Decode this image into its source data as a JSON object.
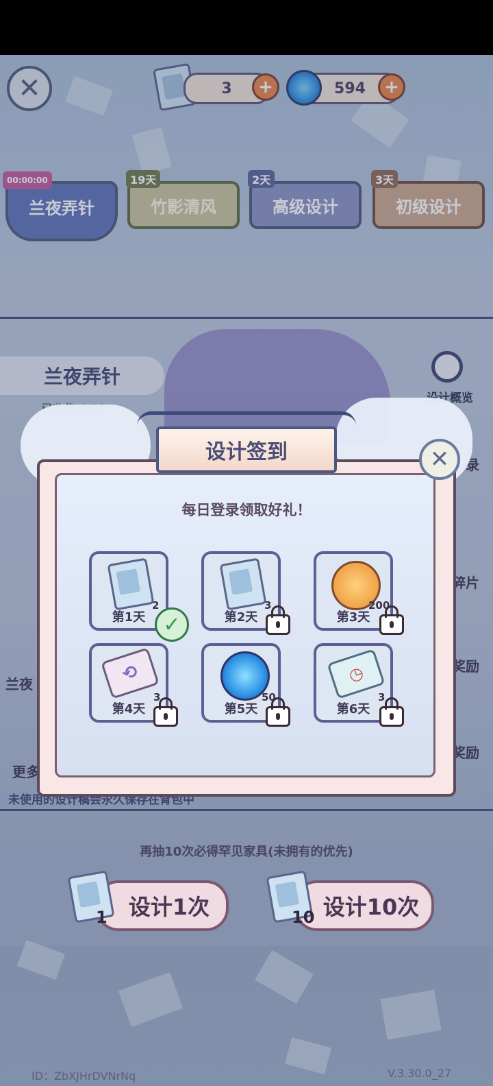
{
  "resources": [
    {
      "icon": "design-scroll-icon",
      "value": "3"
    },
    {
      "icon": "swirl-gem-icon",
      "value": "594"
    }
  ],
  "tabs": [
    {
      "label": "兰夜弄针",
      "tag": "00:00:00",
      "color": "#5b72b8"
    },
    {
      "label": "竹影清风",
      "tag": "19天",
      "color": "#c8c39a"
    },
    {
      "label": "高级设计",
      "tag": "2天",
      "color": "#8a93c2"
    },
    {
      "label": "初级设计",
      "tag": "3天",
      "color": "#c9a98d"
    }
  ],
  "banner": {
    "title": "兰夜弄针",
    "progress": "已收集 0/21"
  },
  "side": {
    "overview": "设计概览",
    "record_suffix": "录",
    "fragment_suffix": "碎片",
    "reward1_suffix": "奖励",
    "reward2_suffix": "奖励",
    "left_label1": "兰夜",
    "left_label2": "更多"
  },
  "notice": "未使用的设计稿会永久保存在背包中",
  "guarantee": "再抽10次必得罕见家具(未拥有的优先)",
  "draw": {
    "single": {
      "label": "设计1次",
      "cost": "1"
    },
    "ten": {
      "label": "设计10次",
      "cost": "10"
    }
  },
  "footer": {
    "id": "ID：ZbXJHrDVNrNq",
    "version": "V.3.30.0_27"
  },
  "modal": {
    "title": "设计签到",
    "subtitle": "每日登录领取好礼！",
    "days": [
      {
        "label": "第1天",
        "count": "2",
        "icon": "design-scroll-icon",
        "state": "claimed"
      },
      {
        "label": "第2天",
        "count": "3",
        "icon": "design-scroll-icon",
        "state": "locked"
      },
      {
        "label": "第3天",
        "count": "200",
        "icon": "gold-coin-icon",
        "state": "locked"
      },
      {
        "label": "第4天",
        "count": "3",
        "icon": "refresh-ticket-icon",
        "state": "locked"
      },
      {
        "label": "第5天",
        "count": "50",
        "icon": "swirl-gem-icon",
        "state": "locked"
      },
      {
        "label": "第6天",
        "count": "3",
        "icon": "timer-ticket-icon",
        "state": "locked"
      }
    ]
  }
}
